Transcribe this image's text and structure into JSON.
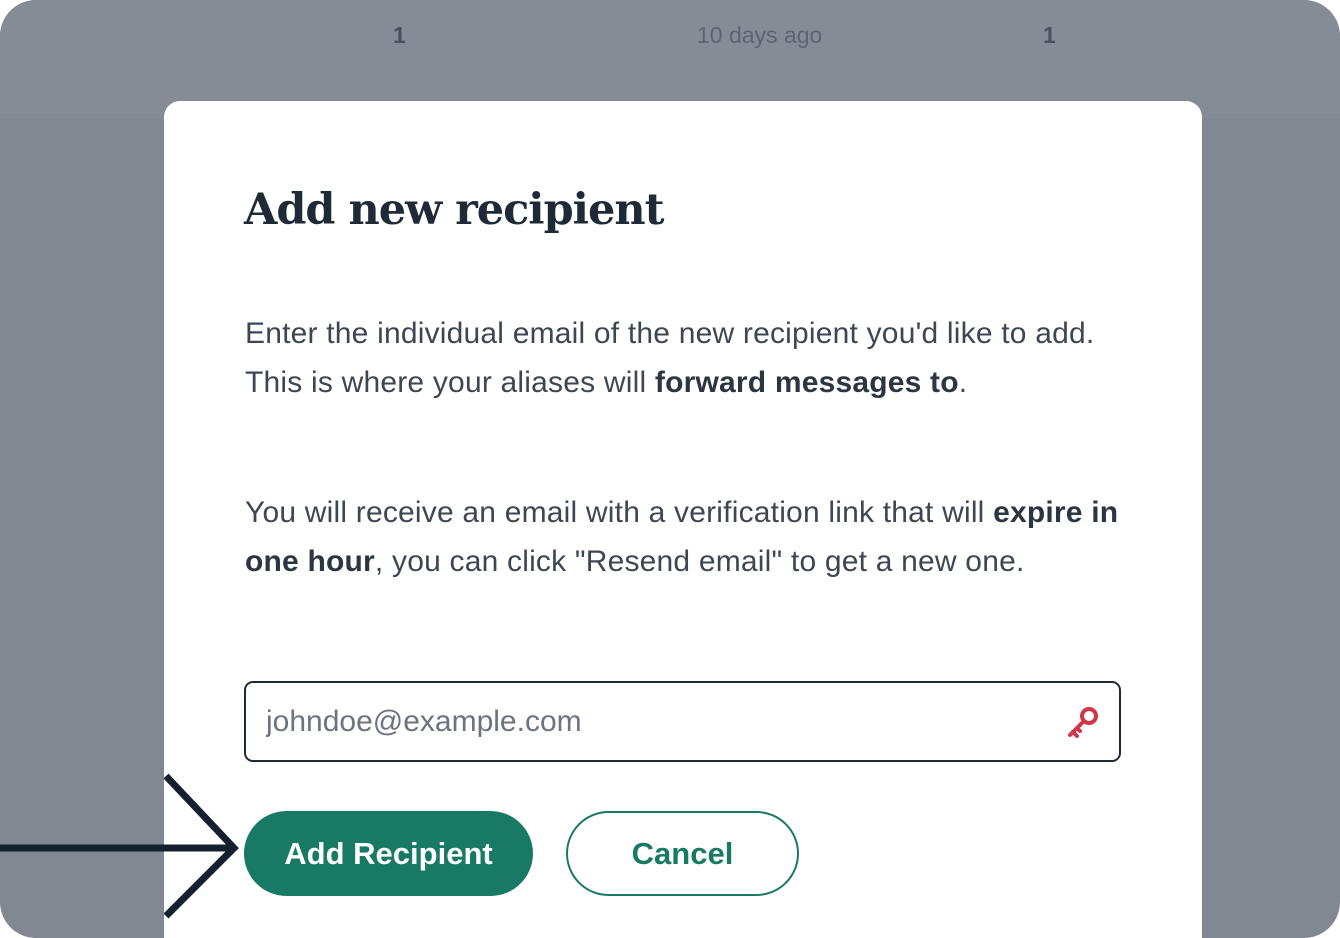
{
  "background_row": {
    "left_count": "1",
    "timestamp": "10 days ago",
    "right_count": "1"
  },
  "modal": {
    "title": "Add new recipient",
    "paragraph1": {
      "text_before": "Enter the individual email of the new recipient you'd like to add. This is where your aliases will ",
      "bold": "forward messages to",
      "text_after": "."
    },
    "paragraph2": {
      "text_before": "You will receive an email with a verification link that will ",
      "bold": "expire in one hour",
      "text_after": ", you can click \"Resend email\" to get a new one."
    },
    "email_input": {
      "value": "",
      "placeholder": "johndoe@example.com",
      "icon": "key-icon"
    },
    "add_button_label": "Add Recipient",
    "cancel_button_label": "Cancel"
  },
  "colors": {
    "accent": "#187a64",
    "overlay": "#818892",
    "key_icon": "#d0364a",
    "title": "#1e2a35"
  }
}
